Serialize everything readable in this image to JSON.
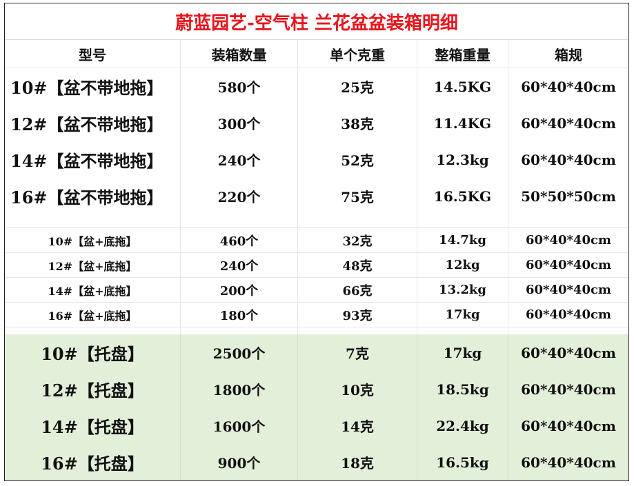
{
  "title": "蔚蓝园艺-空气柱 兰花盆盆装箱明细",
  "headers": [
    "型号",
    "装箱数量",
    "单个克重",
    "整箱重量",
    "箱规"
  ],
  "group1": [
    [
      "10#【盆不带地拖】",
      "580个",
      "25克",
      "14.5KG",
      "60*40*40cm"
    ],
    [
      "12#【盆不带地拖】",
      "300个",
      "38克",
      "11.4KG",
      "60*40*40cm"
    ],
    [
      "14#【盆不带地拖】",
      "240个",
      "52克",
      "12.3kg",
      "60*40*40cm"
    ],
    [
      "16#【盆不带地拖】",
      "220个",
      "75克",
      "16.5KG",
      "50*50*50cm"
    ]
  ],
  "group2": [
    [
      "10#【盆+底拖】",
      "460个",
      "32克",
      "14.7kg",
      "60*40*40cm"
    ],
    [
      "12#【盆+底拖】",
      "240个",
      "48克",
      "12kg",
      "60*40*40cm"
    ],
    [
      "14#【盆+底拖】",
      "200个",
      "66克",
      "13.2kg",
      "60*40*40cm"
    ],
    [
      "16#【盆+底拖】",
      "180个",
      "93克",
      "17kg",
      "60*40*40cm"
    ]
  ],
  "group3": [
    [
      "10#【托盘】",
      "2500个",
      "7克",
      "17kg",
      "60*40*40cm"
    ],
    [
      "12#【托盘】",
      "1800个",
      "10克",
      "18.5kg",
      "60*40*40cm"
    ],
    [
      "14#【托盘】",
      "1600个",
      "14克",
      "22.4kg",
      "60*40*40cm"
    ],
    [
      "16#【托盘】",
      "900个",
      "18克",
      "16.5kg",
      "60*40*40cm"
    ]
  ],
  "colors": {
    "title": "#e8141b",
    "green_fill": "#e2efd9"
  }
}
